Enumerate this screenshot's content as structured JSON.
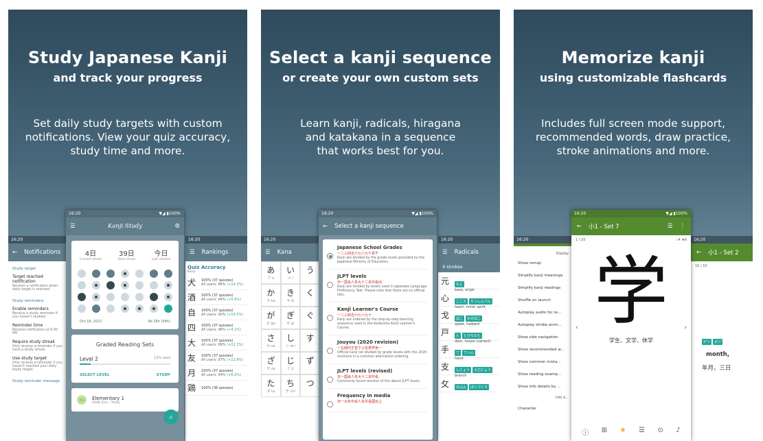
{
  "panels": [
    {
      "title": "Study Japanese Kanji",
      "subtitle": "and track your progress",
      "desc": [
        "Set daily study targets with custom",
        "notifications. View your quiz accuracy,",
        "study time and more."
      ]
    },
    {
      "title": "Select a kanji sequence",
      "subtitle": "or create your own custom sets",
      "desc": [
        "Learn kanji, radicals, hiragana",
        "and katakana in a sequence",
        "that works best for you."
      ]
    },
    {
      "title": "Memorize kanji",
      "subtitle": "using customizable flashcards",
      "desc": [
        "Includes full screen mode support,",
        "recommended words, draw practice,",
        "stroke animations and more."
      ]
    }
  ],
  "status_time": "16:20",
  "battery": "▼◢ ▮100%",
  "notifications": {
    "title": "Notifications",
    "sections": [
      {
        "header": "Study target",
        "items": [
          {
            "t": "Target reached notification",
            "s": "Receive a notification when daily target is reached."
          }
        ]
      },
      {
        "header": "Study reminders",
        "items": [
          {
            "t": "Enable reminders",
            "s": "Receive a study reminder if you haven't studied."
          },
          {
            "t": "Reminder time",
            "s": "Receive notification at 6:00 PM"
          },
          {
            "t": "Require study streak",
            "s": "Only receive a reminder if you have a study streak."
          },
          {
            "t": "Use study target",
            "s": "Only receive a reminder if you haven't reached your daily study target."
          }
        ]
      },
      {
        "header": "Study reminder message",
        "items": []
      }
    ]
  },
  "dashboard": {
    "logo": "Kanji Study",
    "stats": [
      {
        "n": "4日",
        "l": "Current streak"
      },
      {
        "n": "39日",
        "l": "Best streak"
      },
      {
        "n": "今日",
        "l": "Last studied"
      }
    ],
    "date": "Oct 16, 2021",
    "time": "9d 26h (94h)",
    "graded_title": "Graded Reading Sets",
    "level": "Level 2",
    "level_pct": "12% read",
    "select_level": "SELECT LEVEL",
    "study": "STUDY",
    "elem_badge": "小1",
    "elem_title": "Elementary 1",
    "elem_sub": "49dB 42/u - Today"
  },
  "rankings": {
    "title": "Rankings",
    "header": "Quiz Accuracy",
    "sub": "Kanji",
    "rows": [
      {
        "k": "犬",
        "a": "100% (37 quizzes)",
        "b": "All users: 86% ",
        "c": "(+14.3%)"
      },
      {
        "k": "酒",
        "a": "100% (37 quizzes)",
        "b": "All users: 94% ",
        "c": "(+5.6%)"
      },
      {
        "k": "自",
        "a": "100% (37 quizzes)",
        "b": "All users: 90% ",
        "c": "(+10.5%)"
      },
      {
        "k": "四",
        "a": "100% (37 quizzes)",
        "b": "All users: 96% ",
        "c": "(+4.1%)"
      },
      {
        "k": "大",
        "a": "100% (37 quizzes)",
        "b": "All users: 89% ",
        "c": "(+11.3%)"
      },
      {
        "k": "友",
        "a": "100% (37 quizzes)",
        "b": "All users: 87% ",
        "c": "(+12.9%)"
      },
      {
        "k": "月",
        "a": "100% (37 quizzes)",
        "b": "All users: 94% ",
        "c": "(+6.0%)"
      },
      {
        "k": "鶏",
        "a": "100% (36 quizzes)",
        "b": "",
        "c": ""
      }
    ]
  },
  "kana": {
    "title": "Kana",
    "cells": [
      {
        "k": "あ",
        "r": "ア a"
      },
      {
        "k": "い",
        "r": "イ i"
      },
      {
        "k": "う",
        "r": ""
      },
      {
        "k": "か",
        "r": "カ ka"
      },
      {
        "k": "き",
        "r": "キ ki"
      },
      {
        "k": "く",
        "r": ""
      },
      {
        "k": "が",
        "r": "ガ ga"
      },
      {
        "k": "ぎ",
        "r": "ギ gi"
      },
      {
        "k": "ぐ",
        "r": ""
      },
      {
        "k": "さ",
        "r": "サ sa"
      },
      {
        "k": "し",
        "r": "シ shi"
      },
      {
        "k": "す",
        "r": ""
      },
      {
        "k": "ざ",
        "r": "ザ za"
      },
      {
        "k": "じ",
        "r": "ジ ji"
      },
      {
        "k": "ず",
        "r": ""
      },
      {
        "k": "た",
        "r": "タ ta"
      },
      {
        "k": "ち",
        "r": "チ chi"
      },
      {
        "k": "つ",
        "r": ""
      }
    ]
  },
  "sequence": {
    "title": "Select a kanji sequence",
    "items": [
      {
        "t": "Japanese School Grades",
        "k": "一二三四五六七八九十百千",
        "s": "Kanji are divided by the grade levels provided by the Japanese Ministry of Education.",
        "on": true
      },
      {
        "t": "JLPT levels",
        "k": "日一国会人年大十二本中長出",
        "s": "Kanji are divided by levels used in Japanese Language Proficiency Test. Please note that there are no official lists.",
        "on": false
      },
      {
        "t": "Kanji Learner's Course",
        "k": "一二三四五六七八九十",
        "s": "Kanji are ordered by the step-by-step learning sequence used in the Kodansha Kanji Learner's Course.",
        "on": false
      },
      {
        "t": "Jouyou (2020 revision)",
        "k": "一右雨円王音下火花貝学気一",
        "s": "Official kanji list divided by grade levels with the 2020 revisions in a common alternative ordering.",
        "on": false
      },
      {
        "t": "JLPT levels (revised)",
        "k": "日一国会人年大十二本中長",
        "s": "Commonly found revision of the above JLPT levels.",
        "on": false
      },
      {
        "t": "Frequency in media",
        "k": "日一大年中会人本月長国出上",
        "s": "",
        "on": false
      }
    ]
  },
  "radicals": {
    "title": "Radicals",
    "strokes": "4 strokes",
    "rows": [
      {
        "k": "元",
        "chips": [
          "もと"
        ],
        "m": "base, origin"
      },
      {
        "k": "心",
        "chips": [
          "こころ",
          "りっしんべん"
        ],
        "m": "heart, mind, spirit"
      },
      {
        "k": "戈",
        "chips": [
          "ほこ",
          "かのほこ"
        ],
        "m": "spear, halberd"
      },
      {
        "k": "戸",
        "chips": [
          "と",
          "とびらのと"
        ],
        "m": "door, house (variant)"
      },
      {
        "k": "手",
        "chips": [
          "て",
          "てへん"
        ],
        "m": "hand"
      },
      {
        "k": "支",
        "chips": [
          "しにょう",
          "えだにょう"
        ],
        "m": "branch"
      },
      {
        "k": "攵",
        "chips": [
          "のぶん",
          "ぼくづくり"
        ],
        "m": ""
      }
    ]
  },
  "display": {
    "header": "Display",
    "items": [
      "Show romaji",
      "Simplify kanji meanings",
      "Simplify kanji readings",
      "Shuffle on launch",
      "Autoplay audio for re...",
      "Autoplay stroke anim...",
      "Show side navigation",
      "Show recommended w...",
      "Show common mista...",
      "Show reading examp...",
      "Show info details by ..."
    ],
    "info": "Info d...",
    "character": "Character"
  },
  "flashcard": {
    "title": "小1 - Set 7",
    "count": "1 / 10",
    "stars": "☆4 ★6",
    "kanji": "学",
    "words": "学生、文学、休学"
  },
  "flashcard2": {
    "title": "小1 - Set 2",
    "count": "10 / 10",
    "chips": [
      "ゲツ",
      "ガツ"
    ],
    "meaning": "month,",
    "words": "年月、三日"
  },
  "icons": {
    "menu": "☰",
    "back": "←",
    "gear": "⚙",
    "search": "⌕"
  }
}
